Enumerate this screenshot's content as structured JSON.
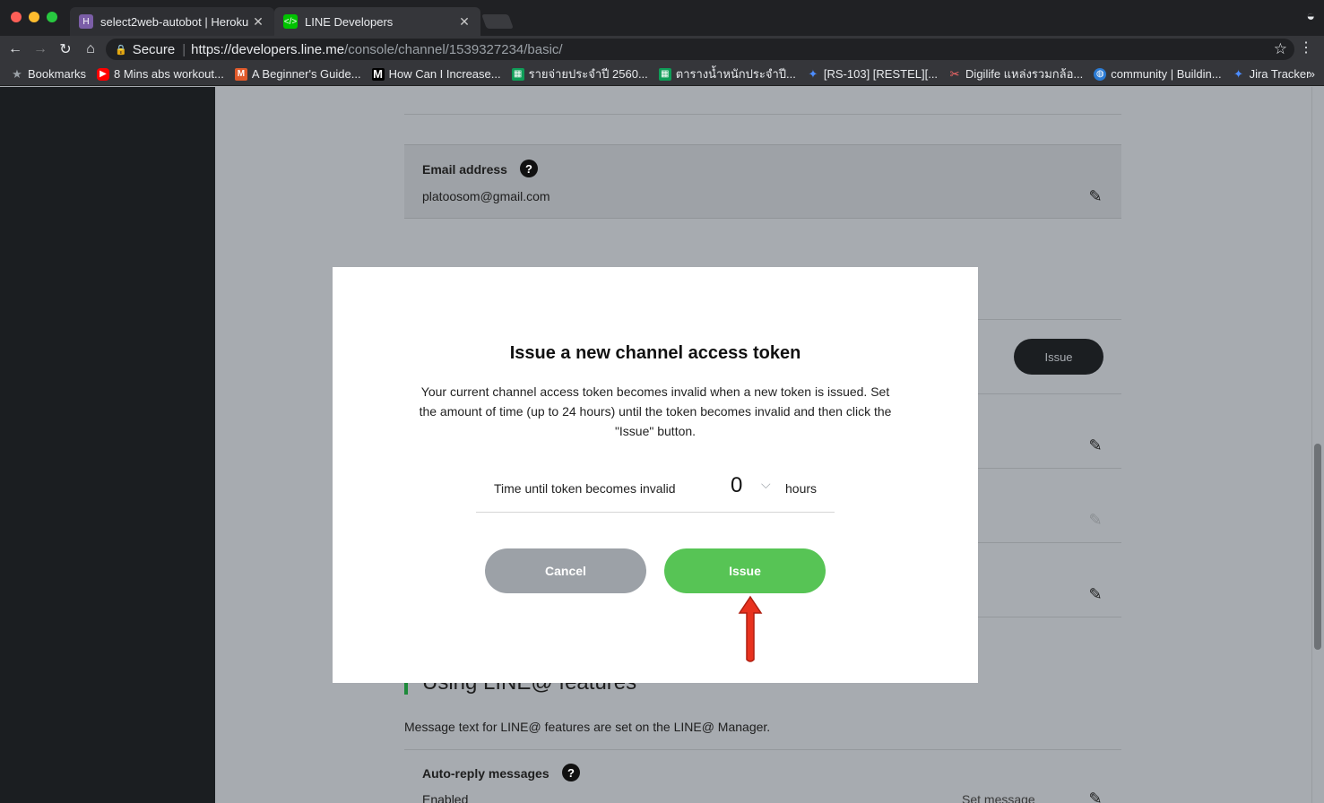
{
  "browser": {
    "tabs": [
      {
        "title": "select2web-autobot | Heroku",
        "favicon": "heroku-icon",
        "favicon_color": "#7b5ea7"
      },
      {
        "title": "LINE Developers",
        "favicon": "code-icon",
        "favicon_color": "#00c300"
      }
    ],
    "omnibox": {
      "secure_label": "Secure",
      "url_host": "https://developers.line.me",
      "url_path": "/console/channel/1539327234/basic/"
    },
    "bookmarks": [
      {
        "label": "Bookmarks",
        "icon": "star-icon"
      },
      {
        "label": "8 Mins abs workout...",
        "icon": "youtube-icon"
      },
      {
        "label": "A Beginner's Guide...",
        "icon": "medium-m-icon"
      },
      {
        "label": "How Can I Increase...",
        "icon": "m-logo-icon"
      },
      {
        "label": "รายจ่ายประจำปี 2560...",
        "icon": "sheets-icon"
      },
      {
        "label": "ตารางน้ำหนักประจำปี...",
        "icon": "sheets-icon"
      },
      {
        "label": "[RS-103] [RESTEL][...",
        "icon": "jira-icon"
      },
      {
        "label": "Digilife แหล่งรวมกล้อ...",
        "icon": "scissors-icon"
      },
      {
        "label": "community | Buildin...",
        "icon": "globe-icon"
      },
      {
        "label": "Jira Tracker",
        "icon": "jira-icon"
      }
    ],
    "bookmarks_more": "»"
  },
  "page": {
    "email": {
      "label": "Email address",
      "value": "platoosom@gmail.com"
    },
    "issue_button_label": "Issue",
    "section_title": "Using LINE@ features",
    "section_desc": "Message text for LINE@ features are set on the LINE@ Manager.",
    "auto_reply": {
      "label": "Auto-reply messages",
      "value": "Enabled",
      "set_message": "Set message"
    }
  },
  "modal": {
    "title": "Issue a new channel access token",
    "description": "Your current channel access token becomes invalid when a new token is issued. Set the amount of time (up to 24 hours) until the token becomes invalid and then click the \"Issue\" button.",
    "time_label": "Time until token becomes invalid",
    "time_value": "0",
    "time_unit": "hours",
    "cancel_label": "Cancel",
    "issue_label": "Issue"
  },
  "colors": {
    "issue_green": "#57c455",
    "cancel_gray": "#9ca1a7",
    "arrow_red": "#e8321e",
    "overlay": "#a7abb0"
  }
}
